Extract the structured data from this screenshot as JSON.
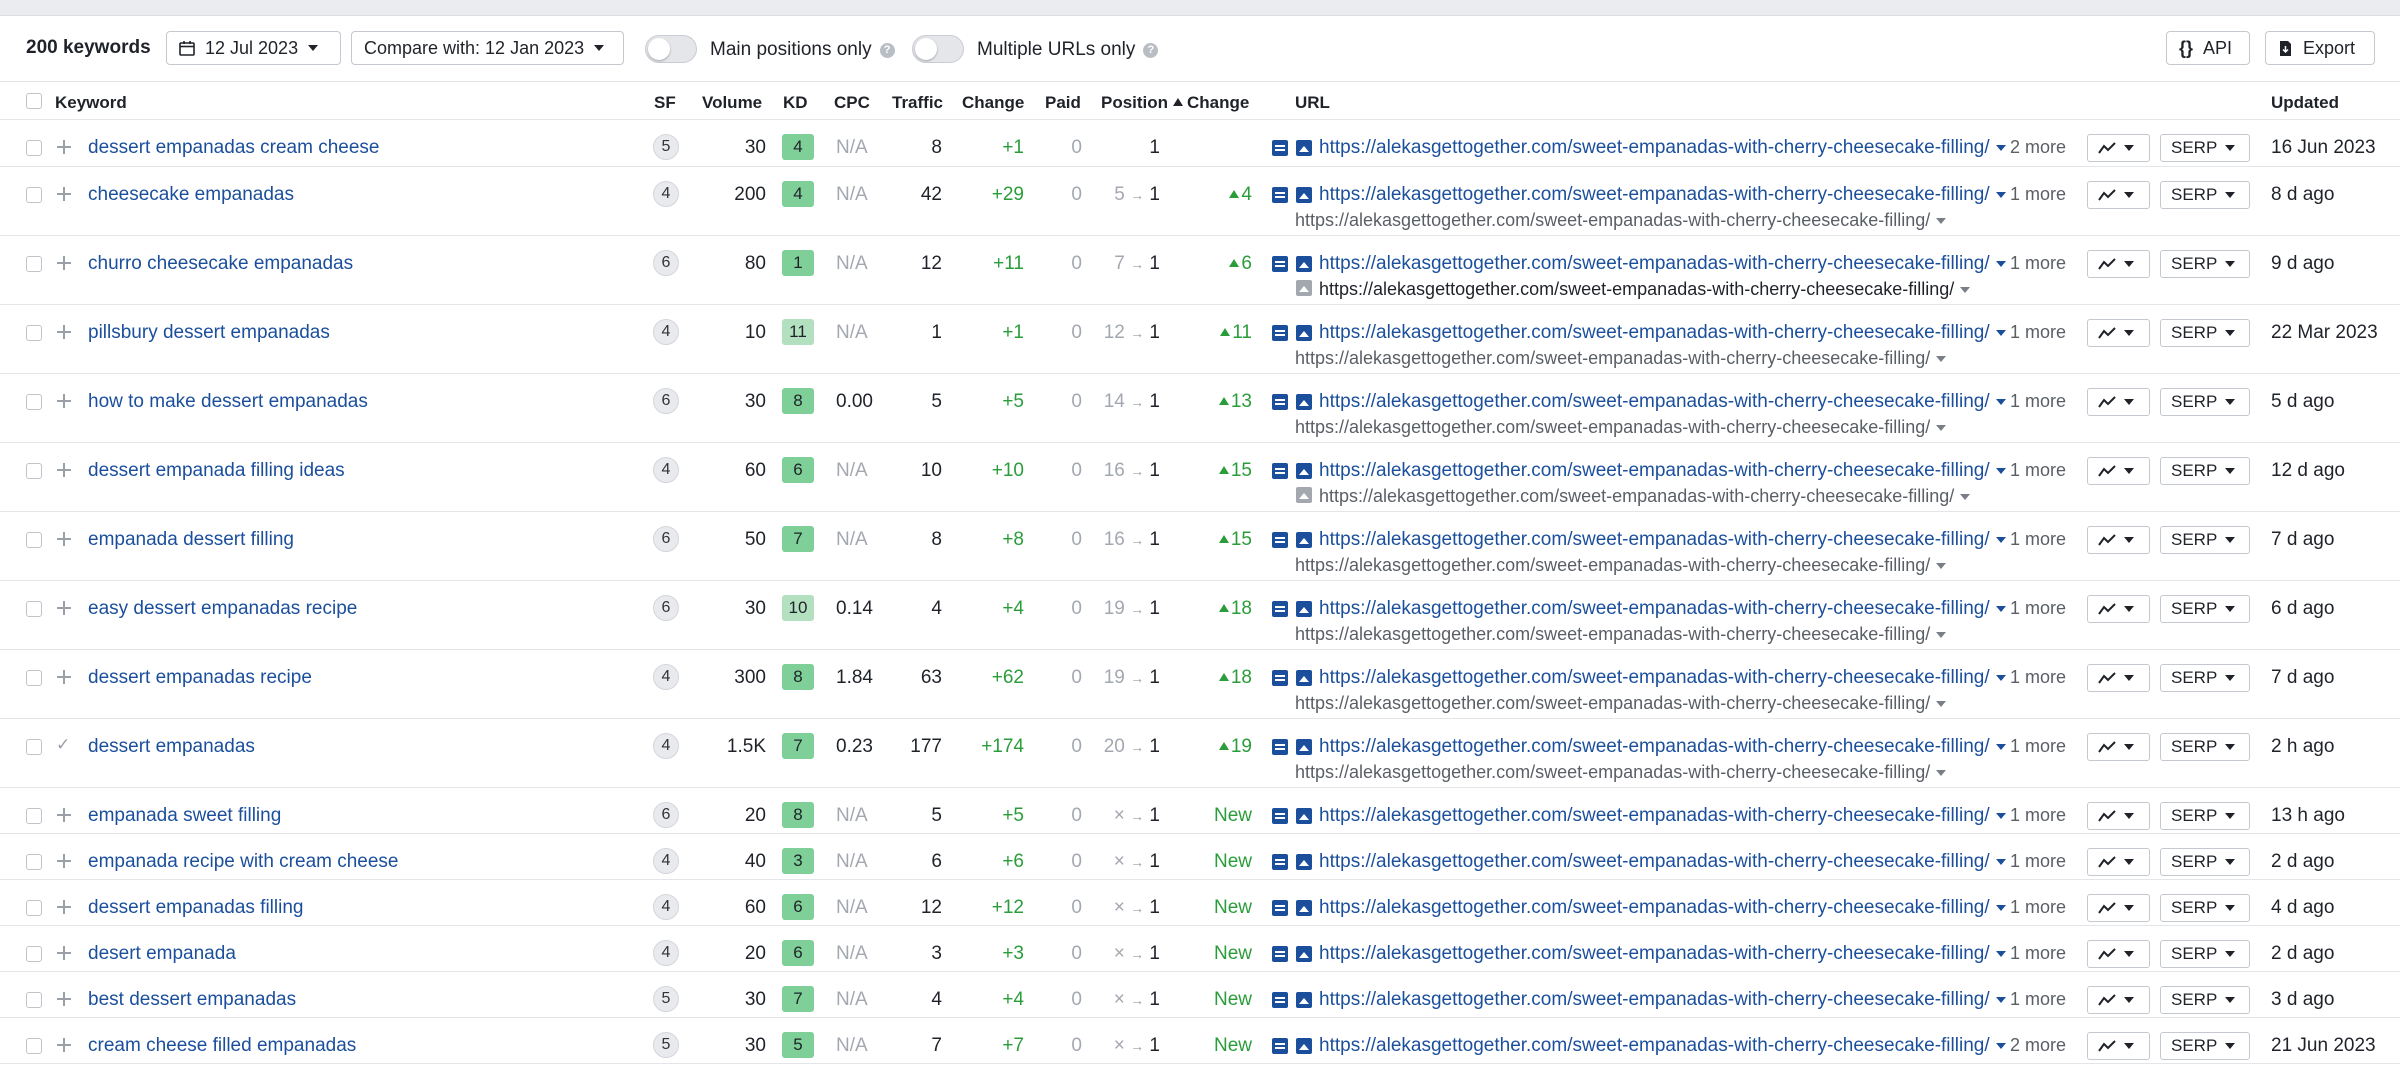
{
  "toolbar": {
    "count": "200 keywords",
    "date": "12 Jul 2023",
    "compare": "Compare with: 12 Jan 2023",
    "main_positions": "Main positions only",
    "multiple_urls": "Multiple URLs only",
    "api": "API",
    "export": "Export"
  },
  "columns": {
    "keyword": "Keyword",
    "sf": "SF",
    "volume": "Volume",
    "kd": "KD",
    "cpc": "CPC",
    "traffic": "Traffic",
    "change": "Change",
    "paid": "Paid",
    "position": "Position",
    "pos_change": "Change",
    "url": "URL",
    "updated": "Updated"
  },
  "colors": {
    "kd_dark": "#7fcf98",
    "kd_light": "#b3e0bf",
    "link": "#1b4f9c",
    "green": "#2a9d3a"
  },
  "serp_label": "SERP",
  "rows": [
    {
      "kw": "dessert empanadas cream cheese",
      "sf": "5",
      "vol": "30",
      "kd": "4",
      "cpc": "N/A",
      "traffic": "8",
      "chg": "+1",
      "paid": "0",
      "from": "",
      "pos": "1",
      "pchg": "",
      "url": "https://alekasgettogether.com/sweet-empanadas-with-cherry-cheesecake-filling/",
      "more": "2 more",
      "url2": "",
      "updated": "16 Jun 2023"
    },
    {
      "kw": "cheesecake empanadas",
      "sf": "4",
      "vol": "200",
      "kd": "4",
      "cpc": "N/A",
      "traffic": "42",
      "chg": "+29",
      "paid": "0",
      "from": "5",
      "pos": "1",
      "pchg": "4",
      "url": "https://alekasgettogether.com/sweet-empanadas-with-cherry-cheesecake-filling/",
      "more": "1 more",
      "url2": "https://alekasgettogether.com/sweet-empanadas-with-cherry-cheesecake-filling/",
      "updated": "8 d ago"
    },
    {
      "kw": "churro cheesecake empanadas",
      "sf": "6",
      "vol": "80",
      "kd": "1",
      "cpc": "N/A",
      "traffic": "12",
      "chg": "+11",
      "paid": "0",
      "from": "7",
      "pos": "1",
      "pchg": "6",
      "url": "https://alekasgettogether.com/sweet-empanadas-with-cherry-cheesecake-filling/",
      "more": "1 more",
      "url2": "https://alekasgettogether.com/sweet-empanadas-with-cherry-cheesecake-filling/",
      "updated": "9 d ago"
    },
    {
      "kw": "pillsbury dessert empanadas",
      "sf": "4",
      "vol": "10",
      "kd": "11",
      "cpc": "N/A",
      "traffic": "1",
      "chg": "+1",
      "paid": "0",
      "from": "12",
      "pos": "1",
      "pchg": "11",
      "url": "https://alekasgettogether.com/sweet-empanadas-with-cherry-cheesecake-filling/",
      "more": "1 more",
      "url2": "https://alekasgettogether.com/sweet-empanadas-with-cherry-cheesecake-filling/",
      "updated": "22 Mar 2023"
    },
    {
      "kw": "how to make dessert empanadas",
      "sf": "6",
      "vol": "30",
      "kd": "8",
      "cpc": "0.00",
      "traffic": "5",
      "chg": "+5",
      "paid": "0",
      "from": "14",
      "pos": "1",
      "pchg": "13",
      "url": "https://alekasgettogether.com/sweet-empanadas-with-cherry-cheesecake-filling/",
      "more": "1 more",
      "url2": "https://alekasgettogether.com/sweet-empanadas-with-cherry-cheesecake-filling/",
      "updated": "5 d ago"
    },
    {
      "kw": "dessert empanada filling ideas",
      "sf": "4",
      "vol": "60",
      "kd": "6",
      "cpc": "N/A",
      "traffic": "10",
      "chg": "+10",
      "paid": "0",
      "from": "16",
      "pos": "1",
      "pchg": "15",
      "url": "https://alekasgettogether.com/sweet-empanadas-with-cherry-cheesecake-filling/",
      "more": "1 more",
      "url2": "https://alekasgettogether.com/sweet-empanadas-with-cherry-cheesecake-filling/",
      "updated": "12 d ago"
    },
    {
      "kw": "empanada dessert filling",
      "sf": "6",
      "vol": "50",
      "kd": "7",
      "cpc": "N/A",
      "traffic": "8",
      "chg": "+8",
      "paid": "0",
      "from": "16",
      "pos": "1",
      "pchg": "15",
      "url": "https://alekasgettogether.com/sweet-empanadas-with-cherry-cheesecake-filling/",
      "more": "1 more",
      "url2": "https://alekasgettogether.com/sweet-empanadas-with-cherry-cheesecake-filling/",
      "updated": "7 d ago"
    },
    {
      "kw": "easy dessert empanadas recipe",
      "sf": "6",
      "vol": "30",
      "kd": "10",
      "cpc": "0.14",
      "traffic": "4",
      "chg": "+4",
      "paid": "0",
      "from": "19",
      "pos": "1",
      "pchg": "18",
      "url": "https://alekasgettogether.com/sweet-empanadas-with-cherry-cheesecake-filling/",
      "more": "1 more",
      "url2": "https://alekasgettogether.com/sweet-empanadas-with-cherry-cheesecake-filling/",
      "updated": "6 d ago"
    },
    {
      "kw": "dessert empanadas recipe",
      "sf": "4",
      "vol": "300",
      "kd": "8",
      "cpc": "1.84",
      "traffic": "63",
      "chg": "+62",
      "paid": "0",
      "from": "19",
      "pos": "1",
      "pchg": "18",
      "url": "https://alekasgettogether.com/sweet-empanadas-with-cherry-cheesecake-filling/",
      "more": "1 more",
      "url2": "https://alekasgettogether.com/sweet-empanadas-with-cherry-cheesecake-filling/",
      "updated": "7 d ago"
    },
    {
      "kw": "dessert empanadas",
      "sf": "4",
      "vol": "1.5K",
      "kd": "7",
      "cpc": "0.23",
      "traffic": "177",
      "chg": "+174",
      "paid": "0",
      "from": "20",
      "pos": "1",
      "pchg": "19",
      "url": "https://alekasgettogether.com/sweet-empanadas-with-cherry-cheesecake-filling/",
      "more": "1 more",
      "url2": "https://alekasgettogether.com/sweet-empanadas-with-cherry-cheesecake-filling/",
      "updated": "2 h ago"
    },
    {
      "kw": "empanada sweet filling",
      "sf": "6",
      "vol": "20",
      "kd": "8",
      "cpc": "N/A",
      "traffic": "5",
      "chg": "+5",
      "paid": "0",
      "from": "×",
      "pos": "1",
      "pchg": "New",
      "url": "https://alekasgettogether.com/sweet-empanadas-with-cherry-cheesecake-filling/",
      "more": "1 more",
      "url2": "",
      "updated": "13 h ago"
    },
    {
      "kw": "empanada recipe with cream cheese",
      "sf": "4",
      "vol": "40",
      "kd": "3",
      "cpc": "N/A",
      "traffic": "6",
      "chg": "+6",
      "paid": "0",
      "from": "×",
      "pos": "1",
      "pchg": "New",
      "url": "https://alekasgettogether.com/sweet-empanadas-with-cherry-cheesecake-filling/",
      "more": "1 more",
      "url2": "",
      "updated": "2 d ago"
    },
    {
      "kw": "dessert empanadas filling",
      "sf": "4",
      "vol": "60",
      "kd": "6",
      "cpc": "N/A",
      "traffic": "12",
      "chg": "+12",
      "paid": "0",
      "from": "×",
      "pos": "1",
      "pchg": "New",
      "url": "https://alekasgettogether.com/sweet-empanadas-with-cherry-cheesecake-filling/",
      "more": "1 more",
      "url2": "",
      "updated": "4 d ago"
    },
    {
      "kw": "desert empanada",
      "sf": "4",
      "vol": "20",
      "kd": "6",
      "cpc": "N/A",
      "traffic": "3",
      "chg": "+3",
      "paid": "0",
      "from": "×",
      "pos": "1",
      "pchg": "New",
      "url": "https://alekasgettogether.com/sweet-empanadas-with-cherry-cheesecake-filling/",
      "more": "1 more",
      "url2": "",
      "updated": "2 d ago"
    },
    {
      "kw": "best dessert empanadas",
      "sf": "5",
      "vol": "30",
      "kd": "7",
      "cpc": "N/A",
      "traffic": "4",
      "chg": "+4",
      "paid": "0",
      "from": "×",
      "pos": "1",
      "pchg": "New",
      "url": "https://alekasgettogether.com/sweet-empanadas-with-cherry-cheesecake-filling/",
      "more": "1 more",
      "url2": "",
      "updated": "3 d ago"
    },
    {
      "kw": "cream cheese filled empanadas",
      "sf": "5",
      "vol": "30",
      "kd": "5",
      "cpc": "N/A",
      "traffic": "7",
      "chg": "+7",
      "paid": "0",
      "from": "×",
      "pos": "1",
      "pchg": "New",
      "url": "https://alekasgettogether.com/sweet-empanadas-with-cherry-cheesecake-filling/",
      "more": "2 more",
      "url2": "",
      "updated": "21 Jun 2023"
    }
  ]
}
